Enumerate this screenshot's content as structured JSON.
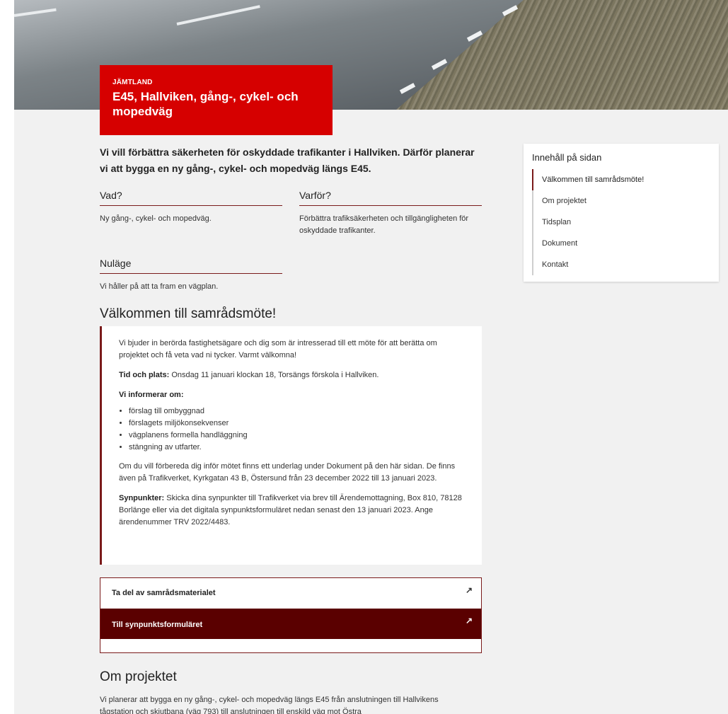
{
  "hero": {
    "region": "JÄMTLAND",
    "title": "E45, Hallviken, gång-, cykel- och mopedväg"
  },
  "intro": "Vi vill förbättra säkerheten för oskyddade trafikanter i Hallviken. Därför planerar vi att bygga en ny gång-, cykel- och mopedväg längs E45.",
  "facts": {
    "what": {
      "heading": "Vad?",
      "text": "Ny gång-, cykel- och mopedväg."
    },
    "why": {
      "heading": "Varför?",
      "text": "Förbättra trafiksäkerheten och tillgängligheten för oskyddade trafikanter."
    },
    "status": {
      "heading": "Nuläge",
      "text": "Vi håller på att ta fram en vägplan."
    }
  },
  "meeting": {
    "heading": "Välkommen till samrådsmöte!",
    "intro": "Vi bjuder in berörda fastighetsägare och dig som är intresserad till ett möte för att berätta om projektet och få veta vad ni tycker. Varmt välkomna!",
    "time_label": "Tid och plats:",
    "time_text": " Onsdag 11 januari klockan 18, Torsängs förskola i Hallviken.",
    "inform_label": "Vi informerar om:",
    "topics": [
      "förslag till ombyggnad",
      "förslagets miljökonsekvenser",
      "vägplanens formella handläggning",
      "stängning av utfarter."
    ],
    "prepare": "Om du vill förbereda dig inför mötet finns ett underlag under Dokument på den här sidan. De finns även på Trafikverket, Kyrkgatan 43 B, Östersund från 23 december 2022 till 13 januari 2023.",
    "feedback_label": "Synpunkter:",
    "feedback_text": " Skicka dina synpunkter till Trafikverket via brev till Ärendemottagning, Box 810, 78128 Borlänge eller via det digitala synpunktsformuläret nedan senast den 13 januari 2023. Ange ärendenummer TRV 2022/4483."
  },
  "links": {
    "material": "Ta del av samrådsmaterialet",
    "form": "Till synpunktsformuläret"
  },
  "project": {
    "heading": "Om projektet",
    "text": "Vi planerar att bygga en ny gång-, cykel- och mopedväg längs E45 från anslutningen till Hallvikens tågstation och skjutbana (väg 793) till anslutningen till enskild väg mot Östra"
  },
  "toc": {
    "title": "Innehåll på sidan",
    "items": [
      "Välkommen till samrådsmöte!",
      "Om projektet",
      "Tidsplan",
      "Dokument",
      "Kontakt"
    ]
  },
  "colors": {
    "brand_red": "#d60000",
    "accent_dark_red": "#7a1a1a",
    "button_dark": "#5a0000"
  },
  "icons": {
    "external_link": "external-link-icon"
  }
}
